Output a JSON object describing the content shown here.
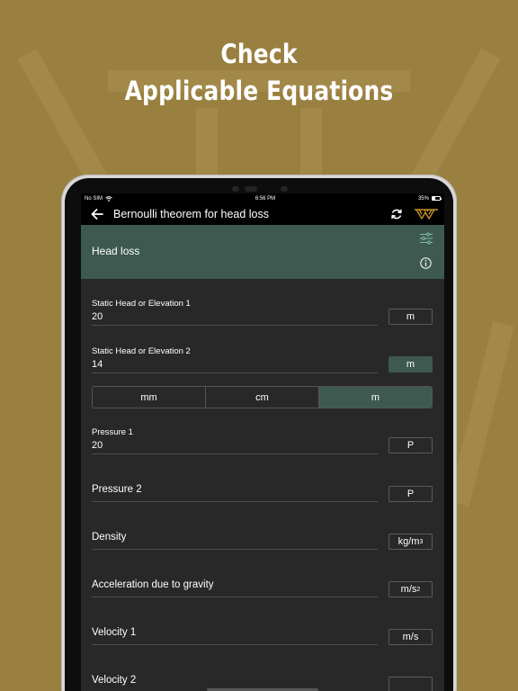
{
  "headline": {
    "line1": "Check",
    "line2": "Applicable Equations"
  },
  "status": {
    "carrier": "No SIM",
    "time": "6:56 PM",
    "battery": "35%"
  },
  "nav": {
    "title": "Bernoulli theorem for head loss"
  },
  "panel": {
    "title": "Head loss"
  },
  "fields": [
    {
      "label": "Static Head or Elevation 1",
      "value": "20",
      "unit": "m"
    },
    {
      "label": "Static Head or Elevation 2",
      "value": "14",
      "unit": "m"
    },
    {
      "label": "Pressure 1",
      "value": "20",
      "unit": "P"
    },
    {
      "label": "Pressure 2",
      "value": "",
      "unit": "P"
    },
    {
      "label": "Density",
      "value": "",
      "unit": "kg/m",
      "unit_sup": "3"
    },
    {
      "label": "Acceleration due to gravity",
      "value": "",
      "unit": "m/s",
      "unit_sup": "2"
    },
    {
      "label": "Velocity 1",
      "value": "",
      "unit": "m/s"
    },
    {
      "label": "Velocity 2",
      "value": "",
      "unit": ""
    }
  ],
  "unit_segment": {
    "options": [
      "mm",
      "cm",
      "m"
    ],
    "selected": "m"
  },
  "colors": {
    "background": "#9a8040",
    "accent": "#3e5a50",
    "screen": "#282828",
    "logo": "#c8922a"
  },
  "icons": [
    "back-arrow-icon",
    "refresh-icon",
    "app-logo-icon",
    "sliders-icon",
    "info-icon",
    "wifi-icon",
    "battery-icon"
  ]
}
